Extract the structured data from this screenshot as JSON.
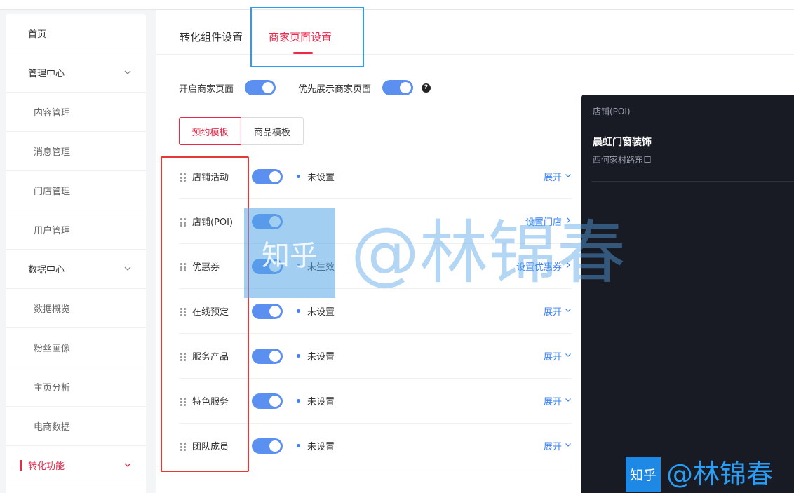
{
  "sidebar": {
    "items": [
      {
        "label": "首页",
        "kind": "top"
      },
      {
        "label": "管理中心",
        "kind": "top",
        "chevron": true
      },
      {
        "label": "内容管理",
        "kind": "sub"
      },
      {
        "label": "消息管理",
        "kind": "sub"
      },
      {
        "label": "门店管理",
        "kind": "sub"
      },
      {
        "label": "用户管理",
        "kind": "sub"
      },
      {
        "label": "数据中心",
        "kind": "top",
        "chevron": true
      },
      {
        "label": "数据概览",
        "kind": "sub"
      },
      {
        "label": "粉丝画像",
        "kind": "sub"
      },
      {
        "label": "主页分析",
        "kind": "sub"
      },
      {
        "label": "电商数据",
        "kind": "sub"
      },
      {
        "label": "转化功能",
        "kind": "top",
        "chevron": true,
        "active": true
      }
    ]
  },
  "tabs": {
    "conversion": "转化组件设置",
    "merchant": "商家页面设置"
  },
  "options": {
    "enable_merchant_page": "开启商家页面",
    "prioritize_merchant_page": "优先展示商家页面",
    "help": "?"
  },
  "templates": {
    "booking": "预约模板",
    "product": "商品模板"
  },
  "rows": [
    {
      "name": "店铺活动",
      "status": "未设置",
      "action": "展开",
      "chevron": "down"
    },
    {
      "name": "店铺(POI)",
      "status": "",
      "action": "设置门店",
      "chevron": "right"
    },
    {
      "name": "优惠券",
      "status": "未生效",
      "action": "设置优惠券",
      "chevron": "right"
    },
    {
      "name": "在线预定",
      "status": "未设置",
      "action": "展开",
      "chevron": "down"
    },
    {
      "name": "服务产品",
      "status": "未设置",
      "action": "展开",
      "chevron": "down"
    },
    {
      "name": "特色服务",
      "status": "未设置",
      "action": "展开",
      "chevron": "down"
    },
    {
      "name": "团队成员",
      "status": "未设置",
      "action": "展开",
      "chevron": "down"
    }
  ],
  "preview": {
    "heading": "店铺(POI)",
    "shop_name": "晨虹门窗装饰",
    "address": "西何家村路东口"
  },
  "watermark": {
    "logo": "知乎",
    "author": "@林锦春"
  },
  "colors": {
    "accent": "#e8294a",
    "toggle": "#5b8ff0",
    "link": "#3b82f6",
    "preview_bg": "#181b24"
  }
}
